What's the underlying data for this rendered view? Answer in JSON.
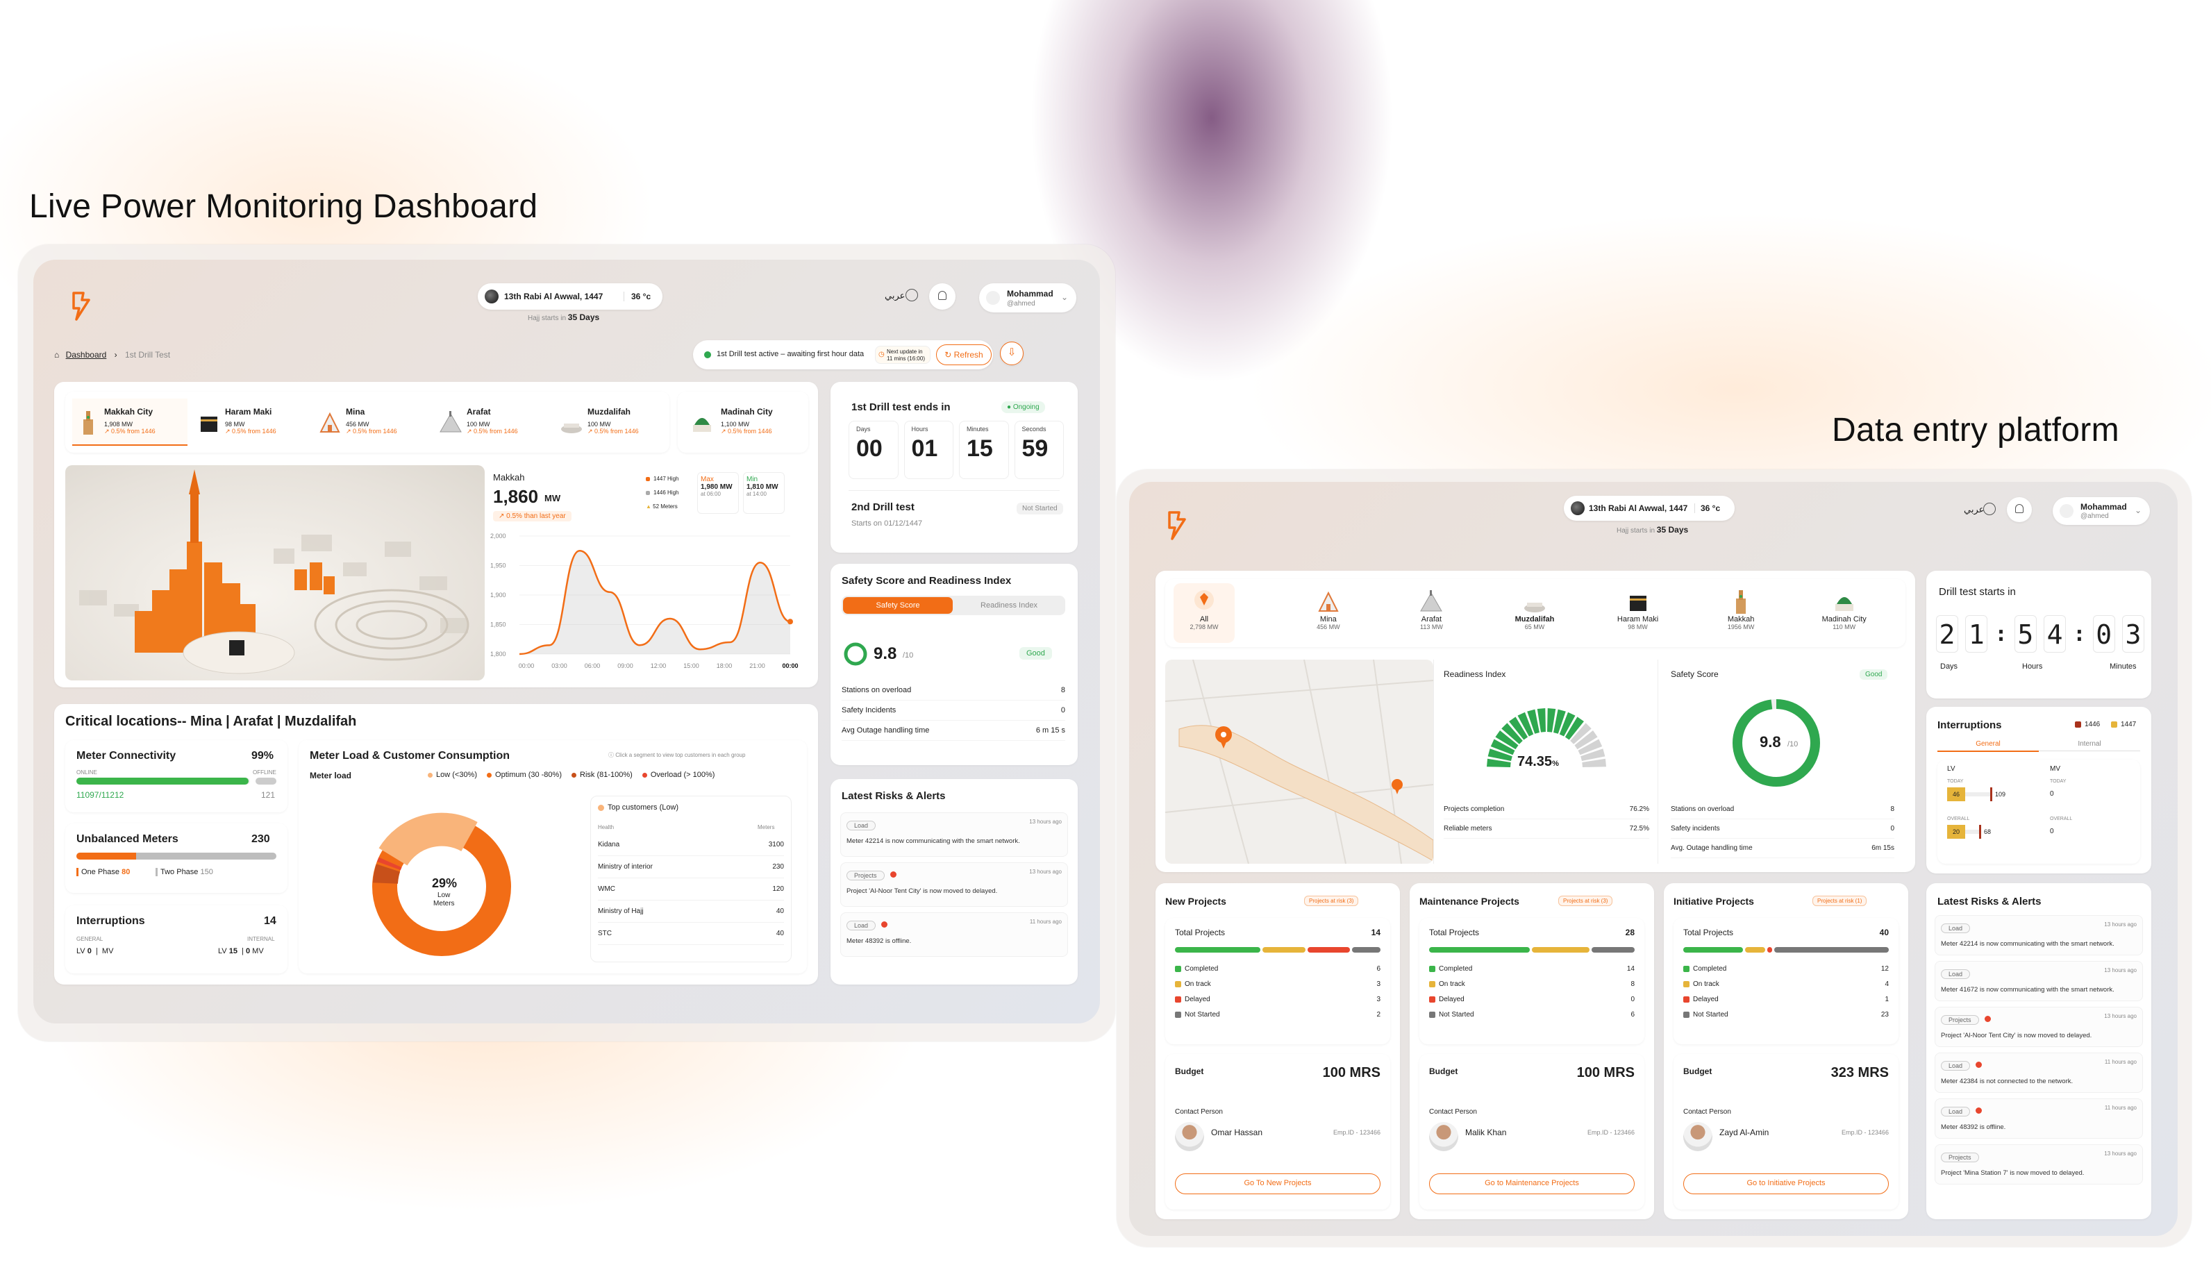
{
  "headings": {
    "left": "Live Power Monitoring Dashboard",
    "right": "Data entry platform"
  },
  "colors": {
    "accent": "#f26d16",
    "good": "#2fa84f",
    "danger": "#e8462e",
    "warn": "#e6b43a"
  },
  "dash": {
    "topbar": {
      "date": "13th Rabi Al Awwal, 1447",
      "temp": "36 °c",
      "hajj_prefix": "Hajj starts in",
      "hajj_days": "35 Days",
      "lang": "عربي",
      "user_name": "Mohammad",
      "user_handle": "@ahmed"
    },
    "breadcrumb": {
      "home": "Dashboard",
      "sep": "›",
      "current": "1st Drill Test"
    },
    "status": {
      "text": "1st Drill test active – awaiting first hour data",
      "update_line1": "Next update in",
      "update_line2": "11 mins (16:00)",
      "refresh": "Refresh"
    },
    "locations": [
      {
        "name": "Makkah City",
        "value": "1,908 MW",
        "delta": "↗ 0.5% from 1446",
        "icon": "clock-tower-icon"
      },
      {
        "name": "Haram Maki",
        "value": "98 MW",
        "delta": "↗ 0.5% from 1446",
        "icon": "kaaba-icon"
      },
      {
        "name": "Mina",
        "value": "456 MW",
        "delta": "↗ 0.5% from 1446",
        "icon": "tent-icon"
      },
      {
        "name": "Arafat",
        "value": "100 MW",
        "delta": "↗ 0.5% from 1446",
        "icon": "mountain-icon"
      },
      {
        "name": "Muzdalifah",
        "value": "100 MW",
        "delta": "↗ 0.5% from 1446",
        "icon": "mosque-icon"
      },
      {
        "name": "Madinah City",
        "value": "1,100 MW",
        "delta": "↗ 0.5% from 1446",
        "icon": "green-dome-icon"
      }
    ],
    "makkah_chart": {
      "city": "Makkah",
      "value": "1,860",
      "unit": "MW",
      "delta": "↗ 0.5% than last year",
      "legend": [
        "1447 High",
        "1446 High",
        "52 Meters"
      ],
      "max_label": "Max",
      "max_value": "1,980 MW",
      "max_time": "at 06:00",
      "min_label": "Min",
      "min_value": "1,810 MW",
      "min_time": "at 14:00"
    },
    "chart_data": {
      "type": "area",
      "title": "Makkah",
      "x": [
        "00:00",
        "03:00",
        "06:00",
        "09:00",
        "12:00",
        "15:00",
        "18:00",
        "21:00",
        "00:00"
      ],
      "yticks": [
        "2,000",
        "1,950",
        "1,900",
        "1,850",
        "1,800"
      ],
      "ylim": [
        1800,
        2000
      ],
      "series": [
        {
          "values": [
            1800,
            1815,
            1975,
            1905,
            1815,
            1860,
            1808,
            1820,
            1955,
            1855
          ]
        }
      ]
    },
    "drill": {
      "title": "1st Drill test ends in",
      "status": "Ongoing",
      "labels": [
        "Days",
        "Hours",
        "Minutes",
        "Seconds"
      ],
      "values": [
        "00",
        "01",
        "15",
        "59"
      ],
      "second_title": "2nd Drill test",
      "second_status": "Not Started",
      "second_date": "Starts on 01/12/1447"
    },
    "safety": {
      "title": "Safety Score and Readiness Index",
      "tab_active": "Safety Score",
      "tab_inactive": "Readiness Index",
      "score": "9.8",
      "outof": "/10",
      "badge": "Good",
      "rows": [
        [
          "Stations on overload",
          "8"
        ],
        [
          "Safety Incidents",
          "0"
        ],
        [
          "Avg Outage handling time",
          "6 m 15 s"
        ]
      ]
    },
    "risks": {
      "title": "Latest Risks & Alerts",
      "items": [
        {
          "tag": "Load",
          "time": "13 hours ago",
          "text": "Meter 42214 is now communicating with the smart network.",
          "flag": false
        },
        {
          "tag": "Projects",
          "time": "13 hours ago",
          "text": "Project 'Al-Noor Tent City' is now moved to delayed.",
          "flag": true
        },
        {
          "tag": "Load",
          "time": "11 hours ago",
          "text": "Meter 48392 is offline.",
          "flag": true
        }
      ]
    },
    "critical": {
      "title": "Critical locations-- Mina | Arafat  | Muzdalifah",
      "connectivity": {
        "title": "Meter Connectivity",
        "pct": "99%",
        "online": "ONLINE",
        "offline": "OFFLINE",
        "online_val": "11097/11212",
        "offline_val": "121",
        "fill": 0.99
      },
      "unbalanced": {
        "title": "Unbalanced Meters",
        "value": "230",
        "one_label": "One Phase",
        "one_val": "80",
        "two_label": "Two Phase",
        "two_val": "150"
      },
      "interruptions": {
        "title": "Interruptions",
        "value": "14",
        "general": "GENERAL",
        "internal": "INTERNAL",
        "lv": "LV",
        "mv": "MV",
        "g_lv": "0",
        "g_mv": "0",
        "i_lv": "15",
        "i_mv": "0"
      }
    },
    "meter_load": {
      "title": "Meter Load & Customer Consumption",
      "hint": "Click a segment to view top customers in each group",
      "subtitle": "Meter load",
      "legend": [
        "Low (<30%)",
        "Optimum (30 -80%)",
        "Risk (81-100%)",
        "Overload (> 100%)"
      ],
      "center_pct": "29%",
      "center_label": "Low",
      "center_sub": "Meters",
      "top_title": "Top customers (Low)",
      "col_health": "Health",
      "col_meters": "Meters",
      "rows": [
        [
          "Kidana",
          "3100"
        ],
        [
          "Ministry of interior",
          "230"
        ],
        [
          "WMC",
          "120"
        ],
        [
          "Ministry of Hajj",
          "40"
        ],
        [
          "STC",
          "40"
        ]
      ]
    }
  },
  "entry": {
    "topbar": {
      "date": "13th Rabi Al Awwal, 1447",
      "temp": "36 °c",
      "hajj_prefix": "Hajj starts in",
      "hajj_days": "35 Days",
      "lang": "عربي",
      "user_name": "Mohammad",
      "user_handle": "@ahmed"
    },
    "tabs": [
      {
        "name": "All",
        "value": "2,798 MW",
        "icon": "all-icon"
      },
      {
        "name": "Mina",
        "value": "456 MW",
        "icon": "tent-icon"
      },
      {
        "name": "Arafat",
        "value": "113 MW",
        "icon": "mountain-icon"
      },
      {
        "name": "Muzdalifah",
        "value": "65 MW",
        "icon": "mosque-icon"
      },
      {
        "name": "Haram Maki",
        "value": "98 MW",
        "icon": "kaaba-icon"
      },
      {
        "name": "Makkah",
        "value": "1956 MW",
        "icon": "clock-tower-icon"
      },
      {
        "name": "Madinah City",
        "value": "110 MW",
        "icon": "green-dome-icon"
      }
    ],
    "drill": {
      "title": "Drill test starts in",
      "digits": [
        "2",
        "1",
        ":",
        "5",
        "4",
        ":",
        "0",
        "3"
      ],
      "labels": [
        "Days",
        "Hours",
        "Minutes"
      ]
    },
    "readiness": {
      "title": "Readiness Index",
      "value": "74.35",
      "unit": "%",
      "rows": [
        [
          "Projects completion",
          "76.2%"
        ],
        [
          "Reliable meters",
          "72.5%"
        ]
      ],
      "fraction": 0.7435
    },
    "safety": {
      "title": "Safety Score",
      "badge": "Good",
      "score": "9.8",
      "outof": "/10",
      "rows": [
        [
          "Stations on overload",
          "8"
        ],
        [
          "Safety incidents",
          "0"
        ],
        [
          "Avg. Outage handling time",
          "6m 15s"
        ]
      ],
      "fraction": 0.98
    },
    "interruptions": {
      "title": "Interruptions",
      "legend": [
        "1446",
        "1447"
      ],
      "tab_active": "General",
      "tab_inactive": "Internal",
      "lv": "LV",
      "mv": "MV",
      "today": "TODAY",
      "overall": "OVERALL",
      "lv_today": [
        "46",
        "109"
      ],
      "lv_overall": [
        "20",
        "68"
      ],
      "mv_today": "0",
      "mv_overall": "0"
    },
    "risks": {
      "title": "Latest Risks & Alerts",
      "items": [
        {
          "tag": "Load",
          "time": "13 hours ago",
          "text": "Meter 42214 is now communicating with the smart network.",
          "flag": false
        },
        {
          "tag": "Load",
          "time": "13 hours ago",
          "text": "Meter 41672 is now communicating with the smart network.",
          "flag": false
        },
        {
          "tag": "Projects",
          "time": "13 hours ago",
          "text": "Project 'Al-Noor Tent City' is now moved to delayed.",
          "flag": true
        },
        {
          "tag": "Load",
          "time": "11 hours ago",
          "text": "Meter 42384 is not connected to the network.",
          "flag": true
        },
        {
          "tag": "Load",
          "time": "11 hours ago",
          "text": "Meter 48392 is offline.",
          "flag": true
        },
        {
          "tag": "Projects",
          "time": "13 hours ago",
          "text": "Project 'Mina Station 7' is now moved to delayed.",
          "flag": false
        }
      ]
    },
    "projects": [
      {
        "title": "New Projects",
        "risk": "Projects at risk (3)",
        "total_label": "Total Projects",
        "total": "14",
        "stats": [
          [
            "Completed",
            "6"
          ],
          [
            "On track",
            "3"
          ],
          [
            "Delayed",
            "3"
          ],
          [
            "Not Started",
            "2"
          ]
        ],
        "budget_label": "Budget",
        "budget": "100 MRS",
        "contact_label": "Contact Person",
        "contact": "Omar Hassan",
        "emp": "Emp.ID - 123466",
        "cta": "Go To New Projects"
      },
      {
        "title": "Maintenance Projects",
        "risk": "Projects at risk (3)",
        "total_label": "Total Projects",
        "total": "28",
        "stats": [
          [
            "Completed",
            "14"
          ],
          [
            "On track",
            "8"
          ],
          [
            "Delayed",
            "0"
          ],
          [
            "Not Started",
            "6"
          ]
        ],
        "budget_label": "Budget",
        "budget": "100 MRS",
        "contact_label": "Contact Person",
        "contact": "Malik Khan",
        "emp": "Emp.ID - 123466",
        "cta": "Go to Maintenance Projects"
      },
      {
        "title": "Initiative Projects",
        "risk": "Projects at risk (1)",
        "total_label": "Total Projects",
        "total": "40",
        "stats": [
          [
            "Completed",
            "12"
          ],
          [
            "On track",
            "4"
          ],
          [
            "Delayed",
            "1"
          ],
          [
            "Not Started",
            "23"
          ]
        ],
        "budget_label": "Budget",
        "budget": "323 MRS",
        "contact_label": "Contact Person",
        "contact": "Zayd Al-Amin",
        "emp": "Emp.ID - 123466",
        "cta": "Go to Initiative Projects"
      }
    ]
  }
}
